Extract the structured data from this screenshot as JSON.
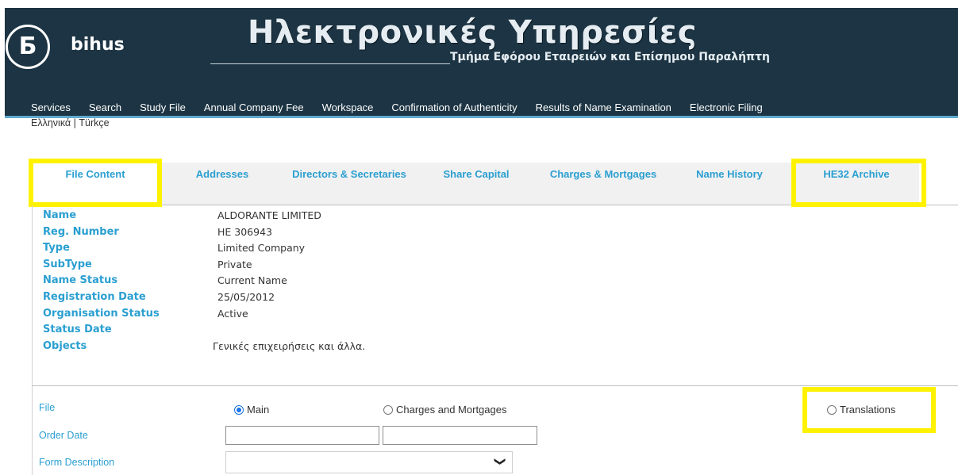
{
  "brand": {
    "logo_glyph": "Б",
    "name": "bihus"
  },
  "header": {
    "title": "Ηλεκτρονικές Υπηρεσίες",
    "subtitle": "Τμήμα Εφόρου Εταιρειών και Επίσημου Παραλήπτη"
  },
  "nav": [
    "Services",
    "Search",
    "Study File",
    "Annual Company Fee",
    "Workspace",
    "Confirmation of Authenticity",
    "Results of Name Examination",
    "Electronic Filing"
  ],
  "languages": {
    "greek": "Ελληνικά",
    "separator": "|",
    "turkish": "Türkçe"
  },
  "tabs": [
    {
      "label": "File Content",
      "active": true,
      "highlighted": true
    },
    {
      "label": "Addresses",
      "active": false,
      "highlighted": false
    },
    {
      "label": "Directors & Secretaries",
      "active": false,
      "highlighted": false
    },
    {
      "label": "Share Capital",
      "active": false,
      "highlighted": false
    },
    {
      "label": "Charges & Mortgages",
      "active": false,
      "highlighted": false
    },
    {
      "label": "Name History",
      "active": false,
      "highlighted": false
    },
    {
      "label": "HE32 Archive",
      "active": false,
      "highlighted": true
    }
  ],
  "company": [
    {
      "label": "Name",
      "value": "ALDORANTE LIMITED"
    },
    {
      "label": "Reg. Number",
      "value": "HE 306943"
    },
    {
      "label": "Type",
      "value": "Limited Company"
    },
    {
      "label": "SubType",
      "value": "Private"
    },
    {
      "label": "Name Status",
      "value": "Current Name"
    },
    {
      "label": "Registration Date",
      "value": "25/05/2012"
    },
    {
      "label": "Organisation Status",
      "value": "Active"
    },
    {
      "label": "Status Date",
      "value": ""
    },
    {
      "label": "Objects",
      "value": "Γενικές επιχειρήσεις και άλλα."
    }
  ],
  "form": {
    "file_label": "File",
    "file_options": [
      {
        "label": "Main",
        "checked": true
      },
      {
        "label": "Charges and Mortgages",
        "checked": false
      },
      {
        "label": "Translations",
        "checked": false,
        "highlighted": true
      }
    ],
    "order_date_label": "Order Date",
    "order_date_from": "",
    "order_date_to": "",
    "form_description_label": "Form Description",
    "form_description_value": ""
  },
  "colors": {
    "header_bg": "#1c3443",
    "accent": "#2a9fd1",
    "highlight": "#fff200"
  }
}
